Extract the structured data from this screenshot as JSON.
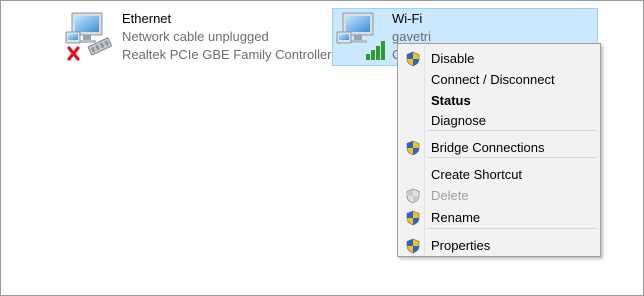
{
  "adapters": {
    "ethernet": {
      "name": "Ethernet",
      "status": "Network cable unplugged",
      "device": "Realtek PCIe GBE Family Controller",
      "icon": "network-adapter-disconnected-icon"
    },
    "wifi": {
      "name": "Wi-Fi",
      "status": "gavetri",
      "device": "C",
      "icon": "network-adapter-wifi-icon"
    }
  },
  "context_menu": {
    "items": [
      {
        "label": "Disable",
        "shield": true
      },
      {
        "label": "Connect / Disconnect",
        "shield": false
      },
      {
        "label": "Status",
        "shield": false,
        "bold": true
      },
      {
        "label": "Diagnose",
        "shield": false
      },
      {
        "label": "Bridge Connections",
        "shield": true
      },
      {
        "label": "Create Shortcut",
        "shield": false
      },
      {
        "label": "Delete",
        "shield": true,
        "disabled": true
      },
      {
        "label": "Rename",
        "shield": true
      },
      {
        "label": "Properties",
        "shield": true
      }
    ]
  },
  "colors": {
    "selection_bg": "#cce8ff",
    "selection_border": "#99d1ff",
    "secondary_text": "#6d6d6d",
    "menu_bg": "#f2f2f2"
  }
}
